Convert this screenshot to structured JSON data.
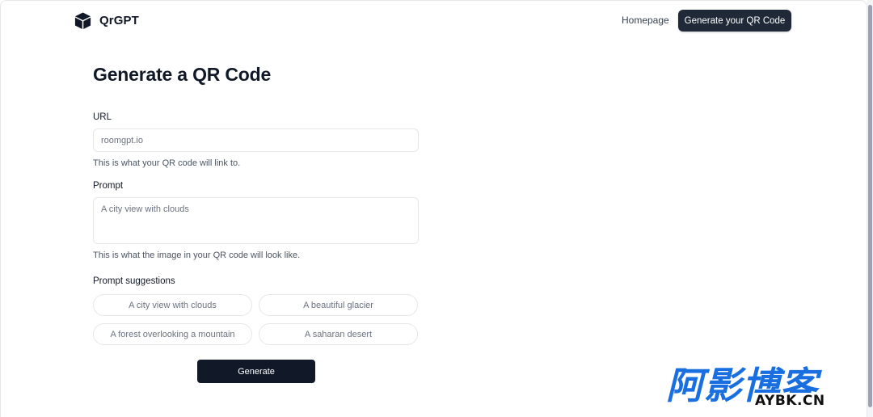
{
  "header": {
    "brand": "QrGPT",
    "brand_icon": "cube-icon",
    "nav_homepage": "Homepage",
    "nav_cta": "Generate your QR Code"
  },
  "main": {
    "title": "Generate a QR Code",
    "url_label": "URL",
    "url_placeholder": "roomgpt.io",
    "url_help": "This is what your QR code will link to.",
    "prompt_label": "Prompt",
    "prompt_placeholder": "A city view with clouds",
    "prompt_help": "This is what the image in your QR code will look like.",
    "suggestions_label": "Prompt suggestions",
    "suggestions": [
      "A city view with clouds",
      "A beautiful glacier",
      "A forest overlooking a mountain",
      "A saharan desert"
    ],
    "generate_label": "Generate"
  },
  "watermark": {
    "cn_text": "阿影博客",
    "en_text": "AYBK.CN"
  },
  "colors": {
    "primary_dark": "#111827",
    "watermark_blue": "#1a6fe0"
  }
}
